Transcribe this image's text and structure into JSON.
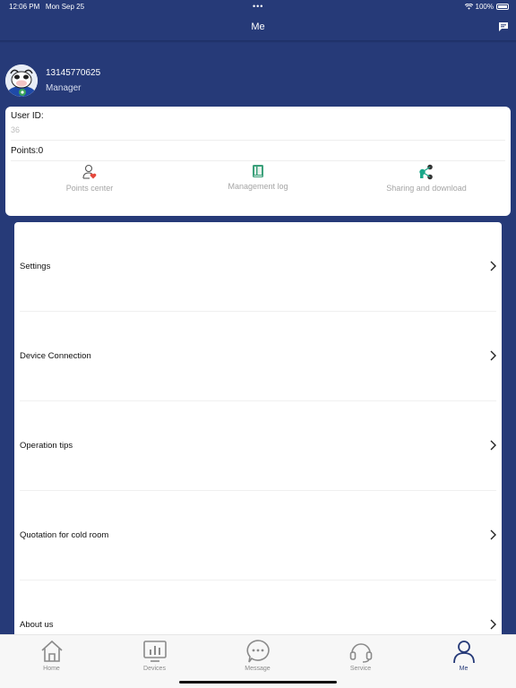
{
  "status": {
    "time": "12:06 PM",
    "date": "Mon Sep 25",
    "dots": "•••",
    "battery": "100%"
  },
  "nav": {
    "title": "Me"
  },
  "profile": {
    "phone": "13145770625",
    "role": "Manager"
  },
  "account": {
    "user_id_label": "User ID:",
    "user_id_value": "36",
    "points_label": "Points:0"
  },
  "actions": [
    {
      "label": "Points center",
      "icon": "person-heart-icon"
    },
    {
      "label": "Management log",
      "icon": "book-icon"
    },
    {
      "label": "Sharing and download",
      "icon": "share-icon"
    }
  ],
  "menu": [
    {
      "label": "Settings"
    },
    {
      "label": "Device Connection"
    },
    {
      "label": "Operation tips"
    },
    {
      "label": "Quotation for cold room"
    },
    {
      "label": "About us"
    }
  ],
  "tabs": [
    {
      "label": "Home",
      "icon": "home-icon"
    },
    {
      "label": "Devices",
      "icon": "devices-icon"
    },
    {
      "label": "Message",
      "icon": "message-icon"
    },
    {
      "label": "Service",
      "icon": "headset-icon"
    },
    {
      "label": "Me",
      "icon": "person-icon"
    }
  ],
  "colors": {
    "brand": "#263a78",
    "heart": "#e5483c",
    "book": "#3aa07a",
    "share": "#1aa88a",
    "tab_active": "#263a78"
  }
}
